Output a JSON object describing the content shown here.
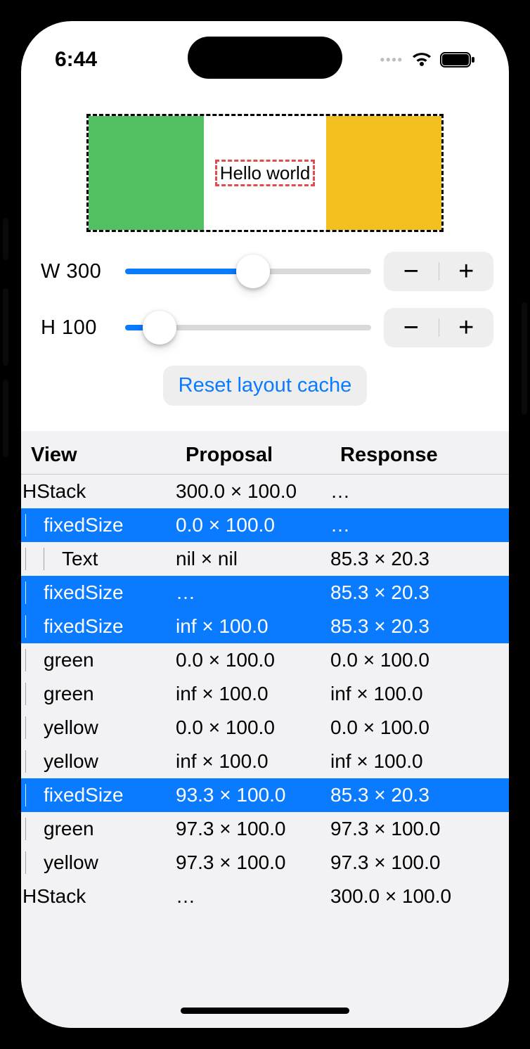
{
  "status": {
    "time": "6:44"
  },
  "preview": {
    "text": "Hello world"
  },
  "sliders": {
    "w": {
      "label": "W 300",
      "pct": 52
    },
    "h": {
      "label": "H 100",
      "pct": 14
    }
  },
  "stepper": {
    "minus": "−",
    "plus": "+"
  },
  "reset_label": "Reset layout cache",
  "table": {
    "headers": {
      "view": "View",
      "proposal": "Proposal",
      "response": "Response"
    },
    "rows": [
      {
        "indent": 0,
        "view": "HStack",
        "proposal": "300.0 × 100.0",
        "response": "…",
        "hl": false
      },
      {
        "indent": 1,
        "view": "fixedSize",
        "proposal": "0.0 × 100.0",
        "response": "…",
        "hl": true
      },
      {
        "indent": 2,
        "view": "Text",
        "proposal": "nil × nil",
        "response": "85.3 × 20.3",
        "hl": false
      },
      {
        "indent": 1,
        "view": "fixedSize",
        "proposal": "…",
        "response": "85.3 × 20.3",
        "hl": true
      },
      {
        "indent": 1,
        "view": "fixedSize",
        "proposal": "inf × 100.0",
        "response": "85.3 × 20.3",
        "hl": true
      },
      {
        "indent": 1,
        "view": "green",
        "proposal": "0.0 × 100.0",
        "response": "0.0 × 100.0",
        "hl": false
      },
      {
        "indent": 1,
        "view": "green",
        "proposal": "inf × 100.0",
        "response": "inf × 100.0",
        "hl": false
      },
      {
        "indent": 1,
        "view": "yellow",
        "proposal": "0.0 × 100.0",
        "response": "0.0 × 100.0",
        "hl": false
      },
      {
        "indent": 1,
        "view": "yellow",
        "proposal": "inf × 100.0",
        "response": "inf × 100.0",
        "hl": false
      },
      {
        "indent": 1,
        "view": "fixedSize",
        "proposal": "93.3 × 100.0",
        "response": "85.3 × 20.3",
        "hl": true
      },
      {
        "indent": 1,
        "view": "green",
        "proposal": "97.3 × 100.0",
        "response": "97.3 × 100.0",
        "hl": false
      },
      {
        "indent": 1,
        "view": "yellow",
        "proposal": "97.3 × 100.0",
        "response": "97.3 × 100.0",
        "hl": false
      },
      {
        "indent": 0,
        "view": "HStack",
        "proposal": "…",
        "response": "300.0 × 100.0",
        "hl": false
      }
    ]
  }
}
